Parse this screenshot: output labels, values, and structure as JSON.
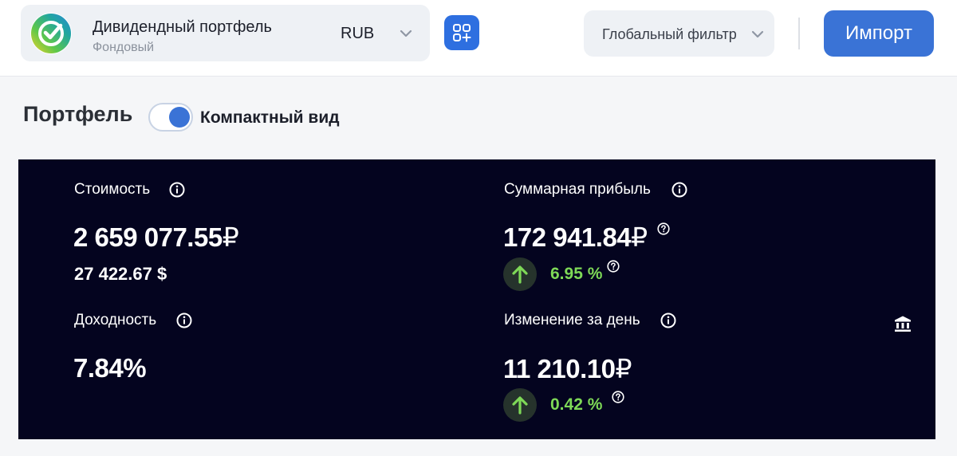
{
  "header": {
    "portfolio_name": "Дивидендный портфель",
    "portfolio_type": "Фондовый",
    "currency": "RUB",
    "global_filter_label": "Глобальный фильтр",
    "import_label": "Импорт",
    "logo_icon": "sber-logo-icon",
    "apps_icon": "apps-add-icon"
  },
  "portfolio_section": {
    "title": "Портфель",
    "compact_toggle_label": "Компактный вид",
    "compact_toggle_on": true
  },
  "stats": {
    "value": {
      "label": "Стоимость",
      "amount": "2 659 077.55",
      "currency_sign": "₽",
      "usd_amount": "27 422.67 $"
    },
    "total_profit": {
      "label": "Суммарная прибыль",
      "amount": "172 941.84",
      "currency_sign": "₽",
      "percent": "6.95 %",
      "trend": "up"
    },
    "yield": {
      "label": "Доходность",
      "amount": "7.84%"
    },
    "day_change": {
      "label": "Изменение за день",
      "amount": "11 210.10",
      "currency_sign": "₽",
      "percent": "0.42 %",
      "trend": "up"
    }
  },
  "colors": {
    "accent": "#3a73d6",
    "apps_button": "#2e6fe0",
    "stats_background": "#04041f",
    "positive": "#7ed957",
    "positive_badge": "#26332c"
  }
}
